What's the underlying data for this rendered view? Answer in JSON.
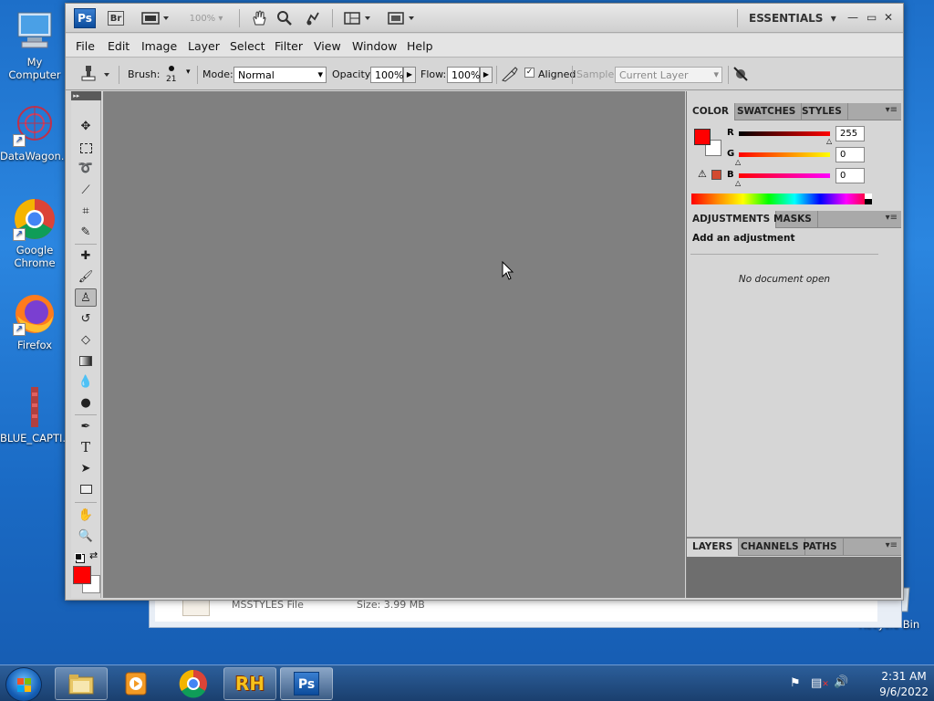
{
  "desktop": {
    "icons": [
      {
        "label": "My Computer",
        "icon": "computer-icon"
      },
      {
        "label": "DataWagon...",
        "icon": "datawagon-icon"
      },
      {
        "label": "Google Chrome",
        "icon": "chrome-icon"
      },
      {
        "label": "Firefox",
        "icon": "firefox-icon"
      },
      {
        "label": "BLUE_CAPTI...",
        "icon": "blue-capti-icon"
      },
      {
        "label": "Recycle Bin",
        "icon": "recycle-bin-icon"
      }
    ]
  },
  "explorer": {
    "file_type": "MSSTYLES File",
    "file_size": "Size: 3.99 MB"
  },
  "photoshop": {
    "logo": "Ps",
    "bridge": "Br",
    "zoom": "100%",
    "workspace": "ESSENTIALS",
    "menu": [
      "File",
      "Edit",
      "Image",
      "Layer",
      "Select",
      "Filter",
      "View",
      "Window",
      "Help"
    ],
    "options": {
      "brush_label": "Brush:",
      "brush_size": "21",
      "mode_label": "Mode:",
      "mode_value": "Normal",
      "opacity_label": "Opacity:",
      "opacity_value": "100%",
      "flow_label": "Flow:",
      "flow_value": "100%",
      "aligned_label": "Aligned",
      "sample_label": "Sample:",
      "sample_value": "Current Layer"
    },
    "color_panel": {
      "tabs": [
        "COLOR",
        "SWATCHES",
        "STYLES"
      ],
      "r_label": "R",
      "r_value": "255",
      "g_label": "G",
      "g_value": "0",
      "b_label": "B",
      "b_value": "0",
      "foreground": "#ff0000",
      "background": "#ffffff"
    },
    "adjustments_panel": {
      "tabs": [
        "ADJUSTMENTS",
        "MASKS"
      ],
      "heading": "Add an adjustment",
      "message": "No document open"
    },
    "layers_panel": {
      "tabs": [
        "LAYERS",
        "CHANNELS",
        "PATHS"
      ]
    }
  },
  "taskbar": {
    "rh_label": "RH",
    "ps_label": "Ps",
    "time": "2:31 AM",
    "date": "9/6/2022"
  }
}
